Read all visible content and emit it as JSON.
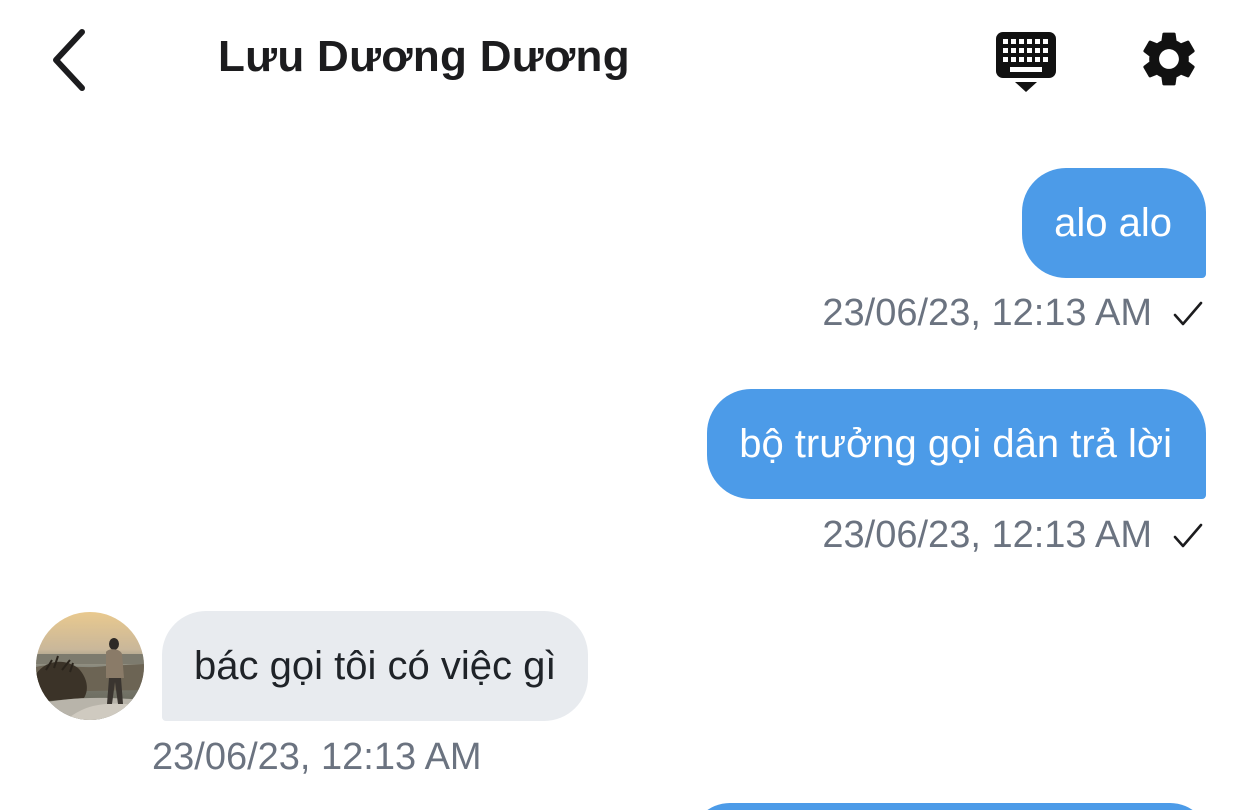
{
  "header": {
    "contact_name": "Lưu Dương Dương"
  },
  "messages": [
    {
      "direction": "outgoing",
      "text": "alo alo",
      "timestamp": "23/06/23, 12:13 AM",
      "status": "sent"
    },
    {
      "direction": "outgoing",
      "text": "bộ trưởng gọi dân trả lời",
      "timestamp": "23/06/23, 12:13 AM",
      "status": "sent"
    },
    {
      "direction": "incoming",
      "text": "bác gọi tôi có việc gì",
      "timestamp": "23/06/23, 12:13 AM"
    }
  ],
  "icons": {
    "back": "chevron-left-icon",
    "keyboard": "keyboard-hide-icon",
    "settings": "gear-icon",
    "sent_check": "checkmark-icon"
  },
  "colors": {
    "outgoing_bubble": "#4c9be8",
    "incoming_bubble": "#e8ebef",
    "timestamp_text": "#6b7380",
    "header_text": "#1c1c1e"
  }
}
